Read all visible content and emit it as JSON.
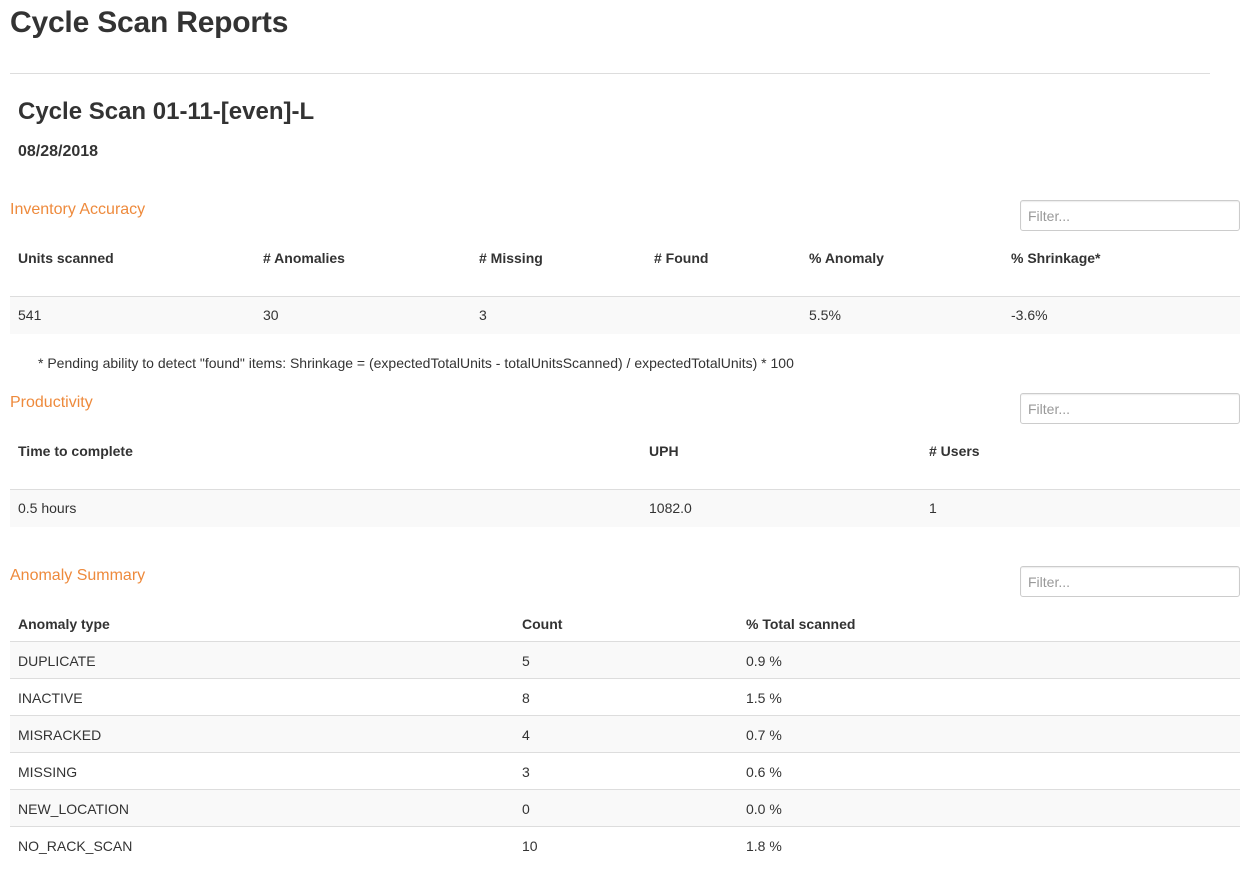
{
  "page": {
    "title": "Cycle Scan Reports"
  },
  "report": {
    "title": "Cycle Scan 01-11-[even]-L",
    "date": "08/28/2018"
  },
  "colors": {
    "section_title": "#ee8a3c",
    "text": "#333333",
    "row_stripe": "#f9f9f9",
    "border": "#dddddd"
  },
  "inventory_accuracy": {
    "title": "Inventory Accuracy",
    "filter_placeholder": "Filter...",
    "columns": [
      "Units scanned",
      "# Anomalies",
      "# Missing",
      "# Found",
      "% Anomaly",
      "% Shrinkage*"
    ],
    "rows": [
      [
        "541",
        "30",
        "3",
        "",
        "5.5%",
        "-3.6%"
      ]
    ],
    "footnote": "* Pending ability to detect \"found\" items: Shrinkage = (expectedTotalUnits - totalUnitsScanned) / expectedTotalUnits) * 100"
  },
  "productivity": {
    "title": "Productivity",
    "filter_placeholder": "Filter...",
    "columns": [
      "Time to complete",
      "UPH",
      "# Users"
    ],
    "rows": [
      [
        "0.5 hours",
        "1082.0",
        "1"
      ]
    ]
  },
  "anomaly_summary": {
    "title": "Anomaly Summary",
    "filter_placeholder": "Filter...",
    "columns": [
      "Anomaly type",
      "Count",
      "% Total scanned"
    ],
    "rows": [
      [
        "DUPLICATE",
        "5",
        "0.9 %"
      ],
      [
        "INACTIVE",
        "8",
        "1.5 %"
      ],
      [
        "MISRACKED",
        "4",
        "0.7 %"
      ],
      [
        "MISSING",
        "3",
        "0.6 %"
      ],
      [
        "NEW_LOCATION",
        "0",
        "0.0 %"
      ],
      [
        "NO_RACK_SCAN",
        "10",
        "1.8 %"
      ]
    ]
  }
}
